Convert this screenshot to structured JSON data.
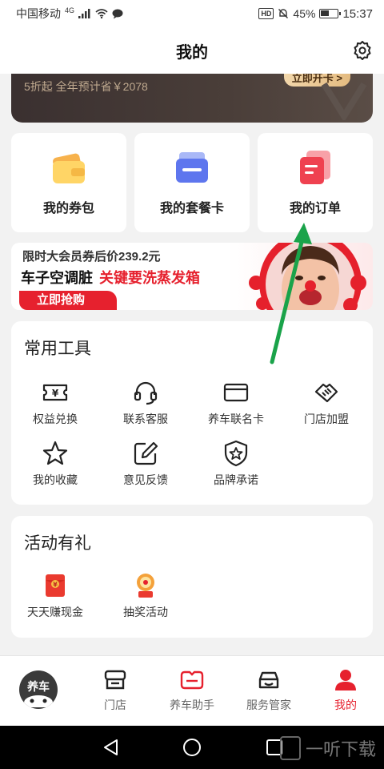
{
  "status": {
    "carrier": "中国移动",
    "network": "4G",
    "battery": "45%",
    "time": "15:37",
    "battery_level": 0.45
  },
  "header": {
    "title": "我的"
  },
  "vip_banner": {
    "text": "5折起 全年预计省￥2078",
    "button": "立即开卡 >"
  },
  "quick_cards": [
    {
      "label": "我的券包",
      "icon": "wallet-icon"
    },
    {
      "label": "我的套餐卡",
      "icon": "card-package-icon"
    },
    {
      "label": "我的订单",
      "icon": "order-icon"
    }
  ],
  "promo": {
    "line1": "限时大会员券后价239.2元",
    "line2a": "车子空调脏",
    "line2b": "关键要洗蒸发箱",
    "button": "立即抢购"
  },
  "tools": {
    "title": "常用工具",
    "items": [
      {
        "label": "权益兑换",
        "icon": "ticket-yen-icon"
      },
      {
        "label": "联系客服",
        "icon": "headset-icon"
      },
      {
        "label": "养车联名卡",
        "icon": "credit-card-icon"
      },
      {
        "label": "门店加盟",
        "icon": "handshake-icon"
      },
      {
        "label": "我的收藏",
        "icon": "star-icon"
      },
      {
        "label": "意见反馈",
        "icon": "edit-icon"
      },
      {
        "label": "品牌承诺",
        "icon": "shield-star-icon"
      }
    ]
  },
  "events": {
    "title": "活动有礼",
    "items": [
      {
        "label": "天天赚现金",
        "icon": "red-envelope-icon"
      },
      {
        "label": "抽奖活动",
        "icon": "lottery-icon"
      }
    ]
  },
  "tabbar": {
    "logo_text": "养车",
    "items": [
      {
        "label": "门店",
        "icon": "store-icon"
      },
      {
        "label": "养车助手",
        "icon": "car-assistant-icon"
      },
      {
        "label": "服务管家",
        "icon": "car-butler-icon"
      },
      {
        "label": "我的",
        "icon": "person-icon"
      }
    ],
    "active": "我的"
  },
  "colors": {
    "accent": "#e6212e",
    "annotation": "#1aa34a"
  },
  "watermark": "一听下载"
}
